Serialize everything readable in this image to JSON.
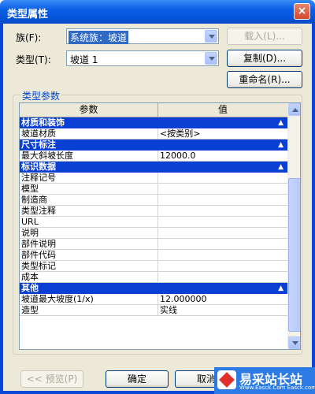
{
  "window": {
    "title": "类型属性",
    "close_glyph": "×"
  },
  "family": {
    "label": "族(F):",
    "value": "系统族：坡道"
  },
  "type": {
    "label": "类型(T):",
    "value": "坡道 1"
  },
  "buttons": {
    "load": "载入(L)...",
    "duplicate": "复制(D)...",
    "rename": "重命名(R)...",
    "preview": "<< 预览(P)",
    "ok": "确定",
    "cancel": "取消"
  },
  "params_group": {
    "title": "类型参数"
  },
  "table": {
    "headers": {
      "param": "参数",
      "value": "值"
    },
    "sections": [
      {
        "title": "材质和装饰",
        "rows": [
          {
            "param": "坡道材质",
            "value": "<按类别>"
          }
        ]
      },
      {
        "title": "尺寸标注",
        "rows": [
          {
            "param": "最大斜坡长度",
            "value": "12000.0"
          }
        ]
      },
      {
        "title": "标识数据",
        "rows": [
          {
            "param": "注释记号",
            "value": ""
          },
          {
            "param": "模型",
            "value": ""
          },
          {
            "param": "制造商",
            "value": ""
          },
          {
            "param": "类型注释",
            "value": ""
          },
          {
            "param": "URL",
            "value": ""
          },
          {
            "param": "说明",
            "value": ""
          },
          {
            "param": "部件说明",
            "value": ""
          },
          {
            "param": "部件代码",
            "value": ""
          },
          {
            "param": "类型标记",
            "value": ""
          },
          {
            "param": "成本",
            "value": ""
          }
        ]
      },
      {
        "title": "其他",
        "rows": [
          {
            "param": "坡道最大坡度(1/x)",
            "value": "12.000000"
          },
          {
            "param": "造型",
            "value": "实线"
          }
        ]
      }
    ]
  },
  "watermark": {
    "text": "易采站长站",
    "sub": "Www.Easck.Com Easck.com"
  }
}
